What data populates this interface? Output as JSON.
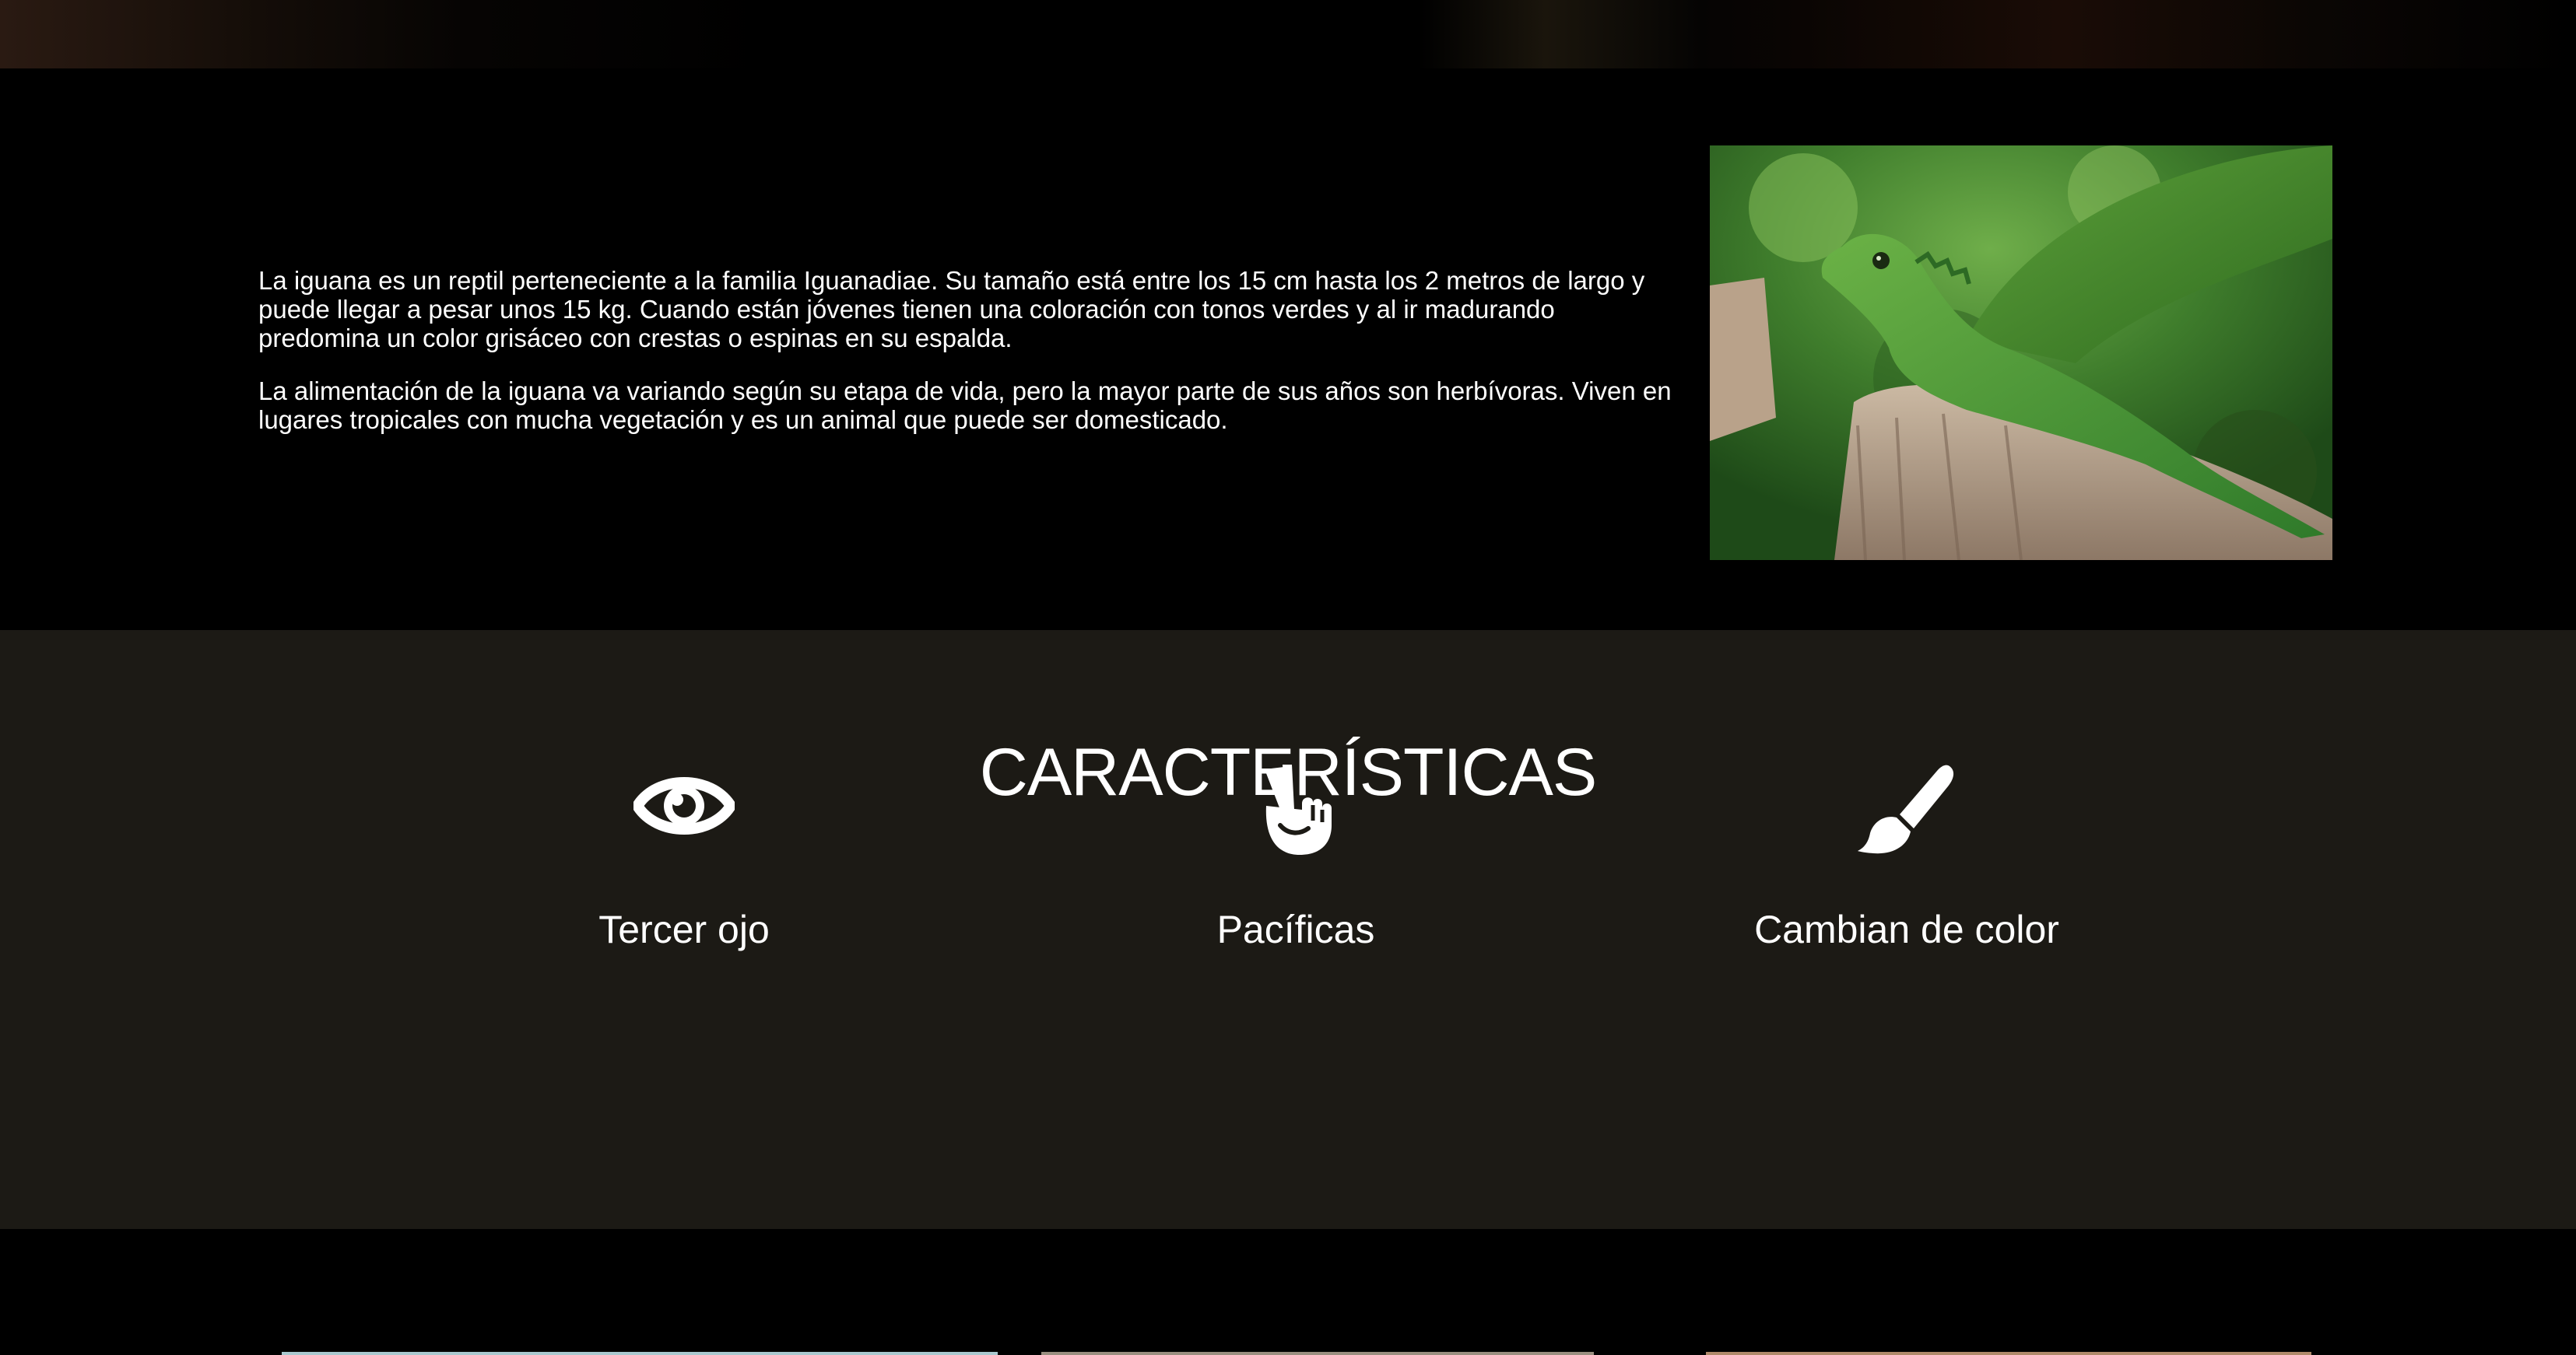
{
  "intro": {
    "paragraph1": "La iguana es un reptil perteneciente a la familia Iguanadiae. Su tamaño está entre los 15 cm hasta los 2 metros de largo y puede llegar a pesar unos 15 kg. Cuando están jóvenes tienen una coloración con tonos verdes y al ir madurando predomina un color grisáceo con crestas o espinas en su espalda.",
    "paragraph2": "La alimentación de la iguana va variando según su etapa de vida, pero la mayor parte de sus años son herbívoras. Viven en lugares tropicales con mucha vegetación y es un animal que puede ser domesticado."
  },
  "features": {
    "title": "CARACTERÍSTICAS",
    "items": [
      {
        "label": "Tercer ojo",
        "icon": "eye-icon"
      },
      {
        "label": "Pacíficas",
        "icon": "peace-hand-icon"
      },
      {
        "label": "Cambian de color",
        "icon": "paintbrush-icon"
      }
    ]
  },
  "colors": {
    "background": "#000000",
    "features_background": "#1c1a15",
    "text": "#ffffff"
  }
}
